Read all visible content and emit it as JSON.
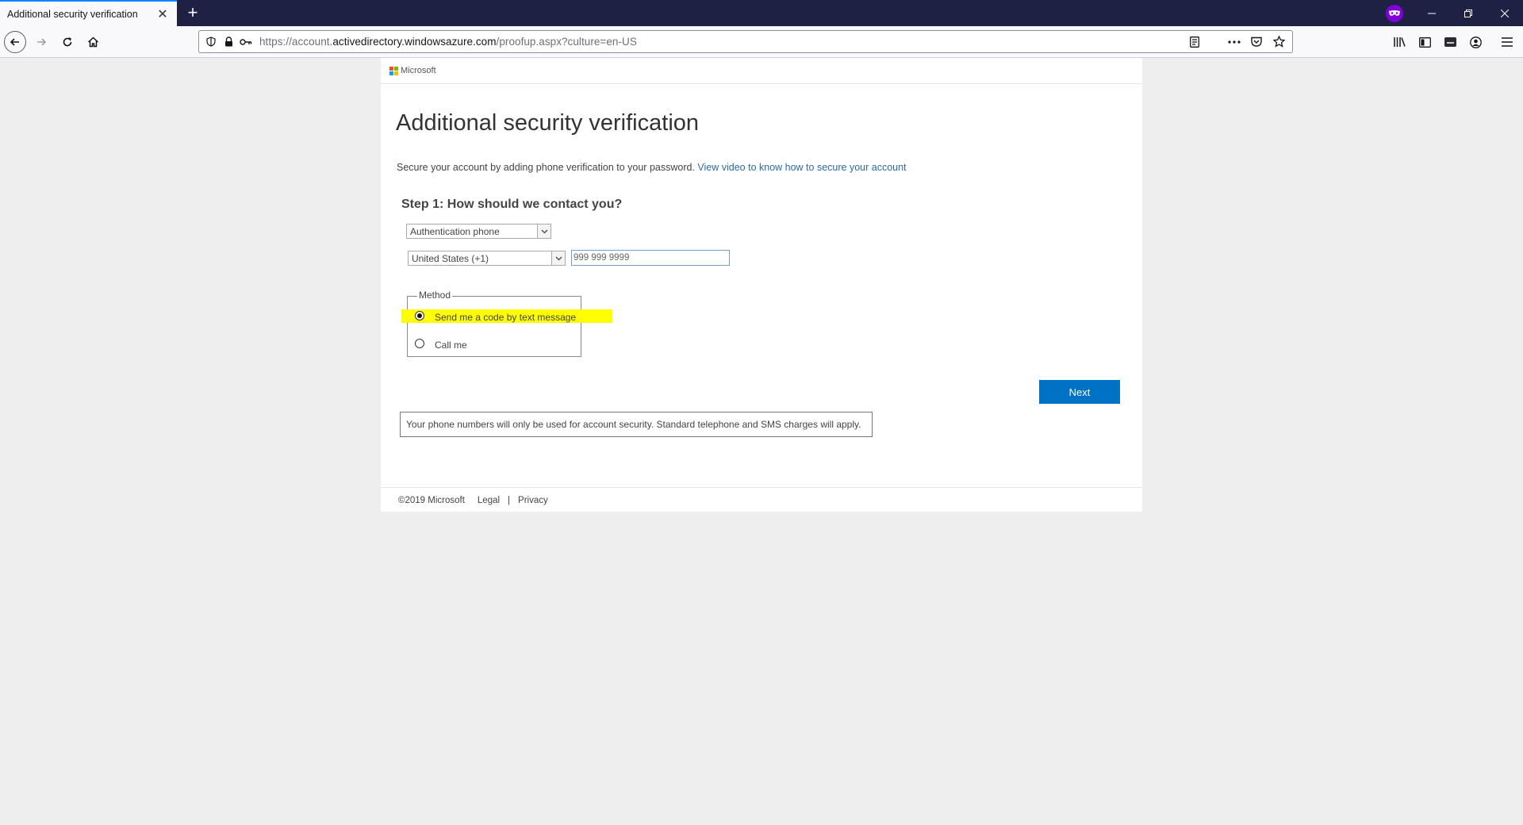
{
  "browser": {
    "tab_title": "Additional security verification",
    "url_scheme_path_prefix": "https://account.",
    "url_host": "activedirectory.windowsazure.com",
    "url_rest": "/proofup.aspx?culture=en-US"
  },
  "page": {
    "brand": "Microsoft",
    "title": "Additional security verification",
    "intro_text": "Secure your account by adding phone verification to your password.",
    "intro_link": "View video to know how to secure your account",
    "step_heading": "Step 1: How should we contact you?",
    "contact_method_select": "Authentication phone",
    "country_select": "United States (+1)",
    "phone_number": "999 999 9999",
    "method_legend": "Method",
    "method_options": [
      {
        "label": "Send me a code by text message",
        "selected": true
      },
      {
        "label": "Call me",
        "selected": false
      }
    ],
    "next_label": "Next",
    "notice": "Your phone numbers will only be used for account security. Standard telephone and SMS charges will apply.",
    "highlight_color": "#ffff00",
    "accent_color": "#0072c6"
  },
  "footer": {
    "copyright": "©2019 Microsoft",
    "legal": "Legal",
    "separator": "|",
    "privacy": "Privacy"
  }
}
